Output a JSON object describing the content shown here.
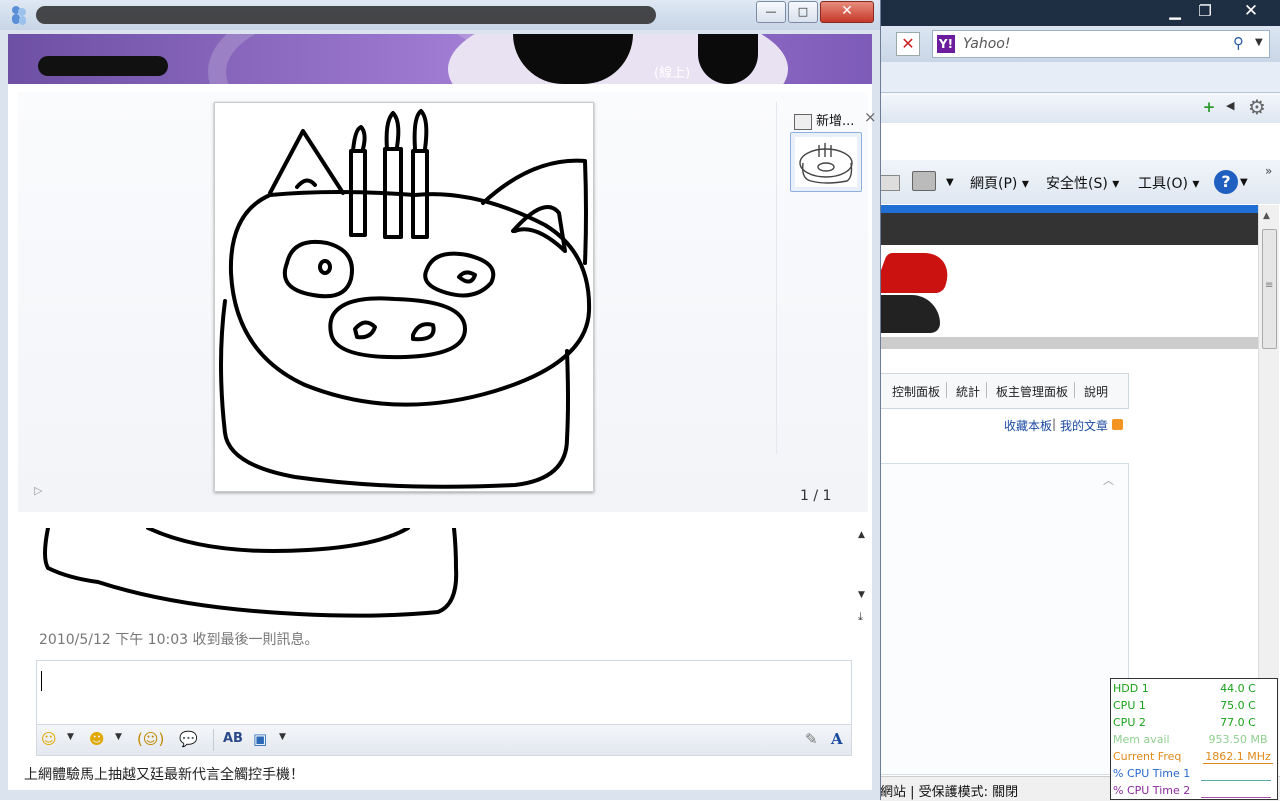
{
  "browser": {
    "search": {
      "placeholder": "Yahoo!",
      "logo": "Y!"
    },
    "menus": {
      "page": "網頁(P)",
      "safety": "安全性(S)",
      "tools": "工具(O)"
    },
    "forum_nav": [
      "控制面板",
      "統計",
      "板主管理面板",
      "說明"
    ],
    "links": {
      "favorite": "收藏本板",
      "separator": "|",
      "my_articles": "我的文章"
    },
    "status_text": "網站 | 受保護模式: 關閉"
  },
  "gadget": {
    "rows": [
      {
        "label": "HDD 1",
        "value": "44.0 C",
        "color": "#1aa01a"
      },
      {
        "label": "CPU 1",
        "value": "75.0 C",
        "color": "#1aa01a"
      },
      {
        "label": "CPU 2",
        "value": "77.0 C",
        "color": "#1aa01a"
      },
      {
        "label": "Mem avail",
        "value": "953.50 MB",
        "color": "#8fd08f"
      },
      {
        "label": "Current Freq",
        "value": "1862.1 MHz",
        "color": "#e08a1a"
      },
      {
        "label": "% CPU Time 1",
        "value": "",
        "color": "#2a6ad0"
      },
      {
        "label": "% CPU Time 2",
        "value": "",
        "color": "#8a2a9a"
      }
    ]
  },
  "msn": {
    "presence": "(線上)",
    "window_controls": {
      "minimize": "—",
      "maximize": "□",
      "close": "✕"
    },
    "share": {
      "add_label": "新增...",
      "close": "×",
      "page_count": "1 / 1"
    },
    "timestamp": "2010/5/12 下午 10:03 收到最後一則訊息。",
    "ad_text": "上網體驗馬上抽越又廷最新代言全觸控手機！"
  }
}
